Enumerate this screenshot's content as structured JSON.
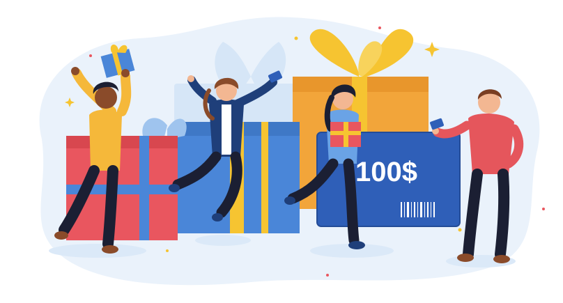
{
  "illustration": {
    "gift_card": {
      "amount": "100$",
      "color": "#2f5fb8"
    },
    "palette": {
      "background_blob": "#eaf2fb",
      "gift_red": "#e9565f",
      "gift_blue": "#4a86d8",
      "gift_orange": "#f2a53a",
      "ribbon_yellow": "#f6c431",
      "ribbon_light_blue": "#9fc4ee",
      "skin_dark": "#8a4b2a",
      "skin_light": "#f3b792",
      "shirt_yellow": "#f5b83a",
      "jacket_navy": "#1f3f7a",
      "sweater_blue": "#6aa3e6",
      "sweater_red": "#e5565c",
      "pants_dark": "#1b1f33"
    },
    "icons": [
      "gift-icon",
      "credit-card-icon",
      "barcode-icon",
      "sparkle-icon"
    ]
  }
}
